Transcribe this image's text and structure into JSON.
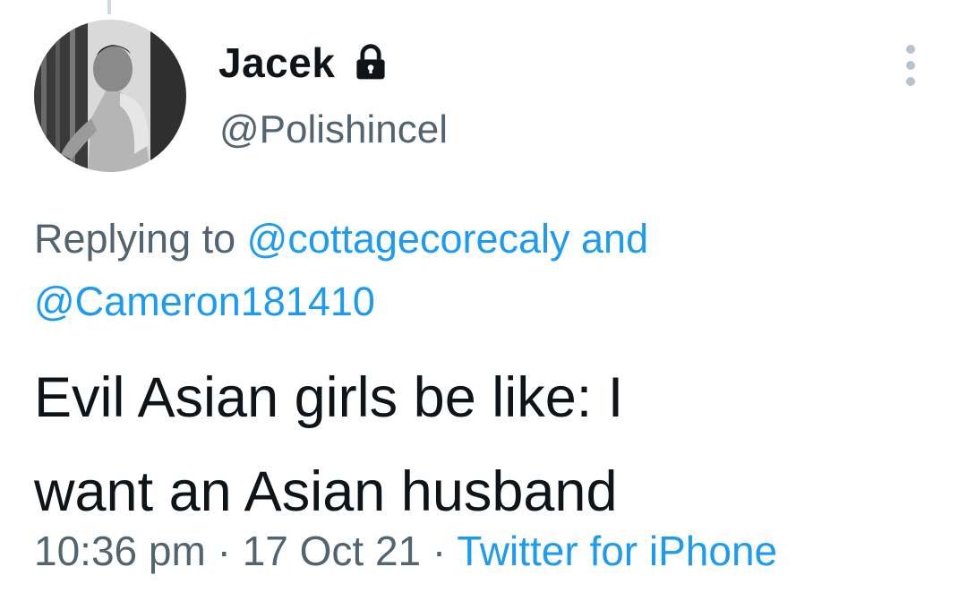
{
  "author": {
    "display_name": "Jacek",
    "handle": "@Polishincel",
    "avatar_icon": "avatar-photo",
    "protected_icon": "lock-icon"
  },
  "reply": {
    "prefix": "Replying to",
    "mentions": [
      "@cottagecorecaly",
      "@Cameron181410"
    ],
    "conjunction": "and"
  },
  "tweet": {
    "line1": "Evil Asian girls be like: I",
    "line2": "want an Asian husband"
  },
  "meta": {
    "time": "10:36 pm",
    "separator": "·",
    "date": "17 Oct 21",
    "source": "Twitter for iPhone"
  },
  "colors": {
    "link": "#1d9bf0",
    "secondary_text": "#536471",
    "primary_text": "#0f1419"
  },
  "icons": {
    "more": "more-vertical-icon"
  }
}
